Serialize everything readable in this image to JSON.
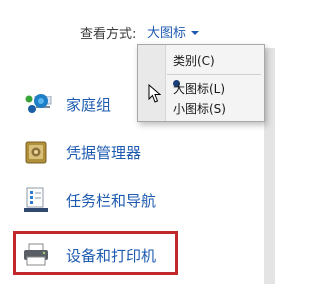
{
  "view": {
    "label": "查看方式:",
    "current": "大图标"
  },
  "items": [
    {
      "name": "family",
      "label": "家庭组"
    },
    {
      "name": "credential",
      "label": "凭据管理器"
    },
    {
      "name": "taskbar",
      "label": "任务栏和导航"
    },
    {
      "name": "devices",
      "label": "设备和打印机"
    }
  ],
  "menu": {
    "options": [
      "类别(C)",
      "大图标(L)",
      "小图标(S)"
    ],
    "selected_index": 1
  },
  "colors": {
    "link": "#1e5bb0",
    "highlight_border": "#c0282c"
  }
}
